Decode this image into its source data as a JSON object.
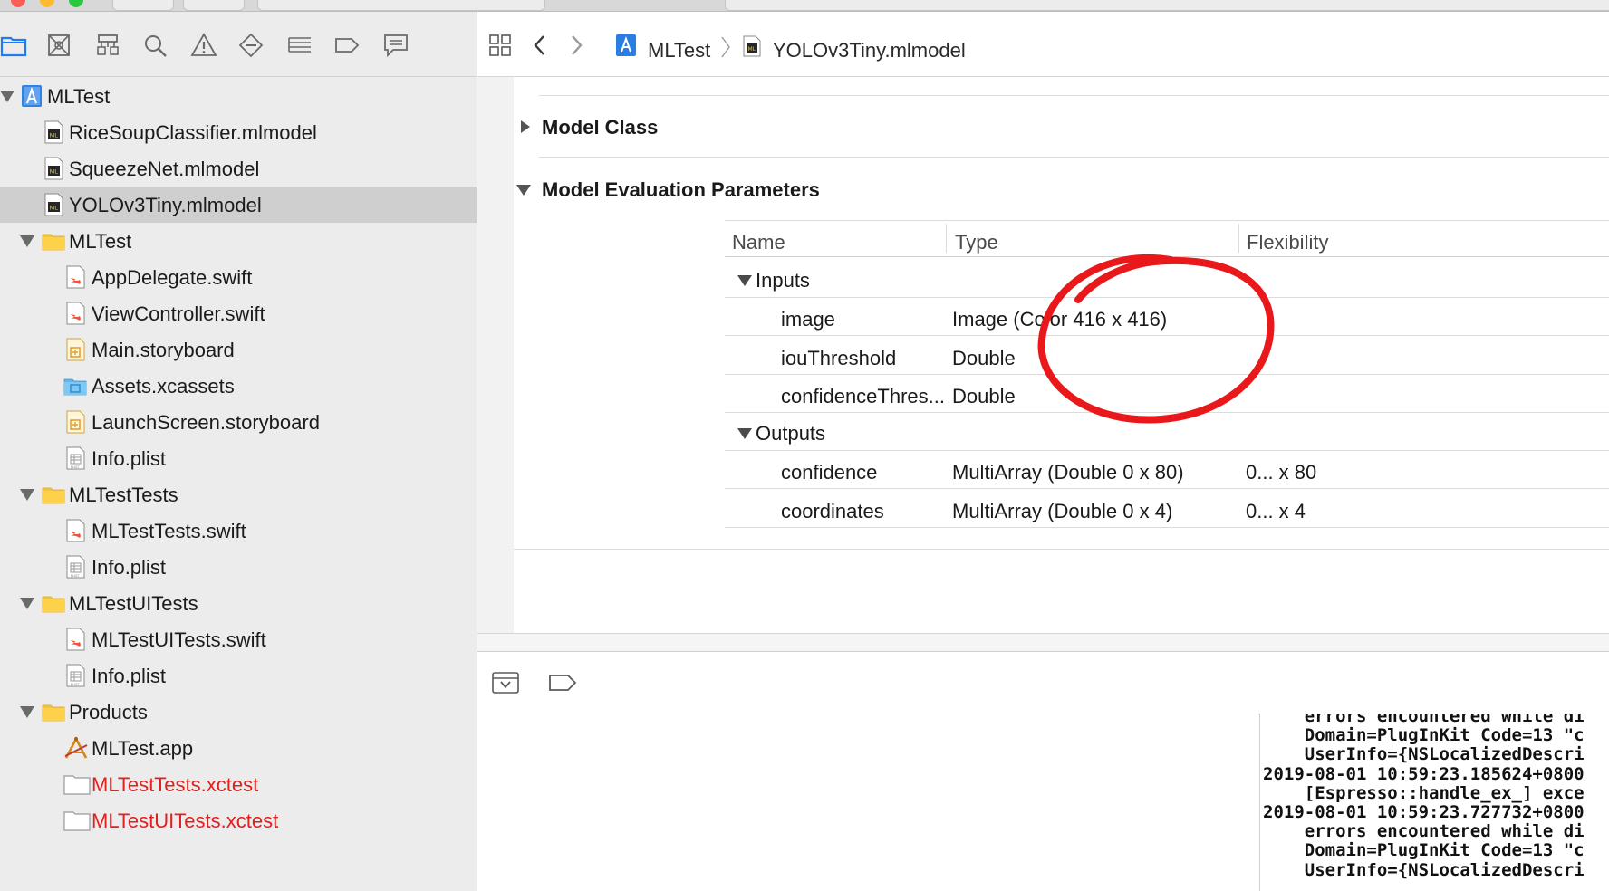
{
  "navigator": {
    "toolbar_icons": [
      "folder-icon",
      "source-control-icon",
      "symbol-icon",
      "find-icon",
      "issue-icon",
      "test-icon",
      "debug-icon",
      "breakpoint-icon",
      "report-icon"
    ],
    "tree": [
      {
        "label": "MLTest",
        "icon": "project-icon",
        "level": 0,
        "disclosure": "open"
      },
      {
        "label": "RiceSoupClassifier.mlmodel",
        "icon": "mlmodel-icon",
        "level": 1
      },
      {
        "label": "SqueezeNet.mlmodel",
        "icon": "mlmodel-icon",
        "level": 1
      },
      {
        "label": "YOLOv3Tiny.mlmodel",
        "icon": "mlmodel-icon",
        "level": 1,
        "selected": true
      },
      {
        "label": "MLTest",
        "icon": "folder-icon",
        "level": 1,
        "disclosure": "open"
      },
      {
        "label": "AppDelegate.swift",
        "icon": "swift-file-icon",
        "level": 2
      },
      {
        "label": "ViewController.swift",
        "icon": "swift-file-icon",
        "level": 2
      },
      {
        "label": "Main.storyboard",
        "icon": "storyboard-icon",
        "level": 2
      },
      {
        "label": "Assets.xcassets",
        "icon": "assets-folder-icon",
        "level": 2
      },
      {
        "label": "LaunchScreen.storyboard",
        "icon": "storyboard-icon",
        "level": 2
      },
      {
        "label": "Info.plist",
        "icon": "plist-icon",
        "level": 2
      },
      {
        "label": "MLTestTests",
        "icon": "folder-icon",
        "level": 1,
        "disclosure": "open"
      },
      {
        "label": "MLTestTests.swift",
        "icon": "swift-file-icon",
        "level": 2
      },
      {
        "label": "Info.plist",
        "icon": "plist-icon",
        "level": 2
      },
      {
        "label": "MLTestUITests",
        "icon": "folder-icon",
        "level": 1,
        "disclosure": "open"
      },
      {
        "label": "MLTestUITests.swift",
        "icon": "swift-file-icon",
        "level": 2
      },
      {
        "label": "Info.plist",
        "icon": "plist-icon",
        "level": 2
      },
      {
        "label": "Products",
        "icon": "folder-icon",
        "level": 1,
        "disclosure": "open"
      },
      {
        "label": "MLTest.app",
        "icon": "app-icon",
        "level": 2
      },
      {
        "label": "MLTestTests.xctest",
        "icon": "xctest-icon",
        "level": 2,
        "missing": true
      },
      {
        "label": "MLTestUITests.xctest",
        "icon": "xctest-icon",
        "level": 2,
        "missing": true
      }
    ]
  },
  "jumpbar": {
    "project": "MLTest",
    "file": "YOLOv3Tiny.mlmodel"
  },
  "editor": {
    "model_class_title": "Model Class",
    "params_title": "Model Evaluation Parameters",
    "table": {
      "headers": {
        "name": "Name",
        "type": "Type",
        "flexibility": "Flexibility"
      },
      "inputs_label": "Inputs",
      "outputs_label": "Outputs",
      "inputs": [
        {
          "name": "image",
          "type": "Image (Color 416 x 416)",
          "flex": ""
        },
        {
          "name": "iouThreshold",
          "type": "Double",
          "flex": ""
        },
        {
          "name": "confidenceThres...",
          "type": "Double",
          "flex": ""
        }
      ],
      "outputs": [
        {
          "name": "confidence",
          "type": "MultiArray (Double 0 x 80)",
          "flex": "0... x 80"
        },
        {
          "name": "coordinates",
          "type": "MultiArray (Double 0 x 4)",
          "flex": "0... x 4"
        }
      ]
    }
  },
  "console": {
    "lines": [
      "    errors encountered while di",
      "    Domain=PlugInKit Code=13 \"c",
      "    UserInfo={NSLocalizedDescri",
      "2019-08-01 10:59:23.185624+0800",
      "    [Espresso::handle_ex_] exce",
      "2019-08-01 10:59:23.727732+0800",
      "    errors encountered while di",
      "    Domain=PlugInKit Code=13 \"c",
      "    UserInfo={NSLocalizedDescri"
    ]
  },
  "colors": {
    "annotation_circle": "#e8181b",
    "missing_file_text": "#e0201e",
    "selection": "#cfcfcf",
    "sidebar_bg": "#ececec",
    "accent_blue": "#1d7cf2"
  }
}
